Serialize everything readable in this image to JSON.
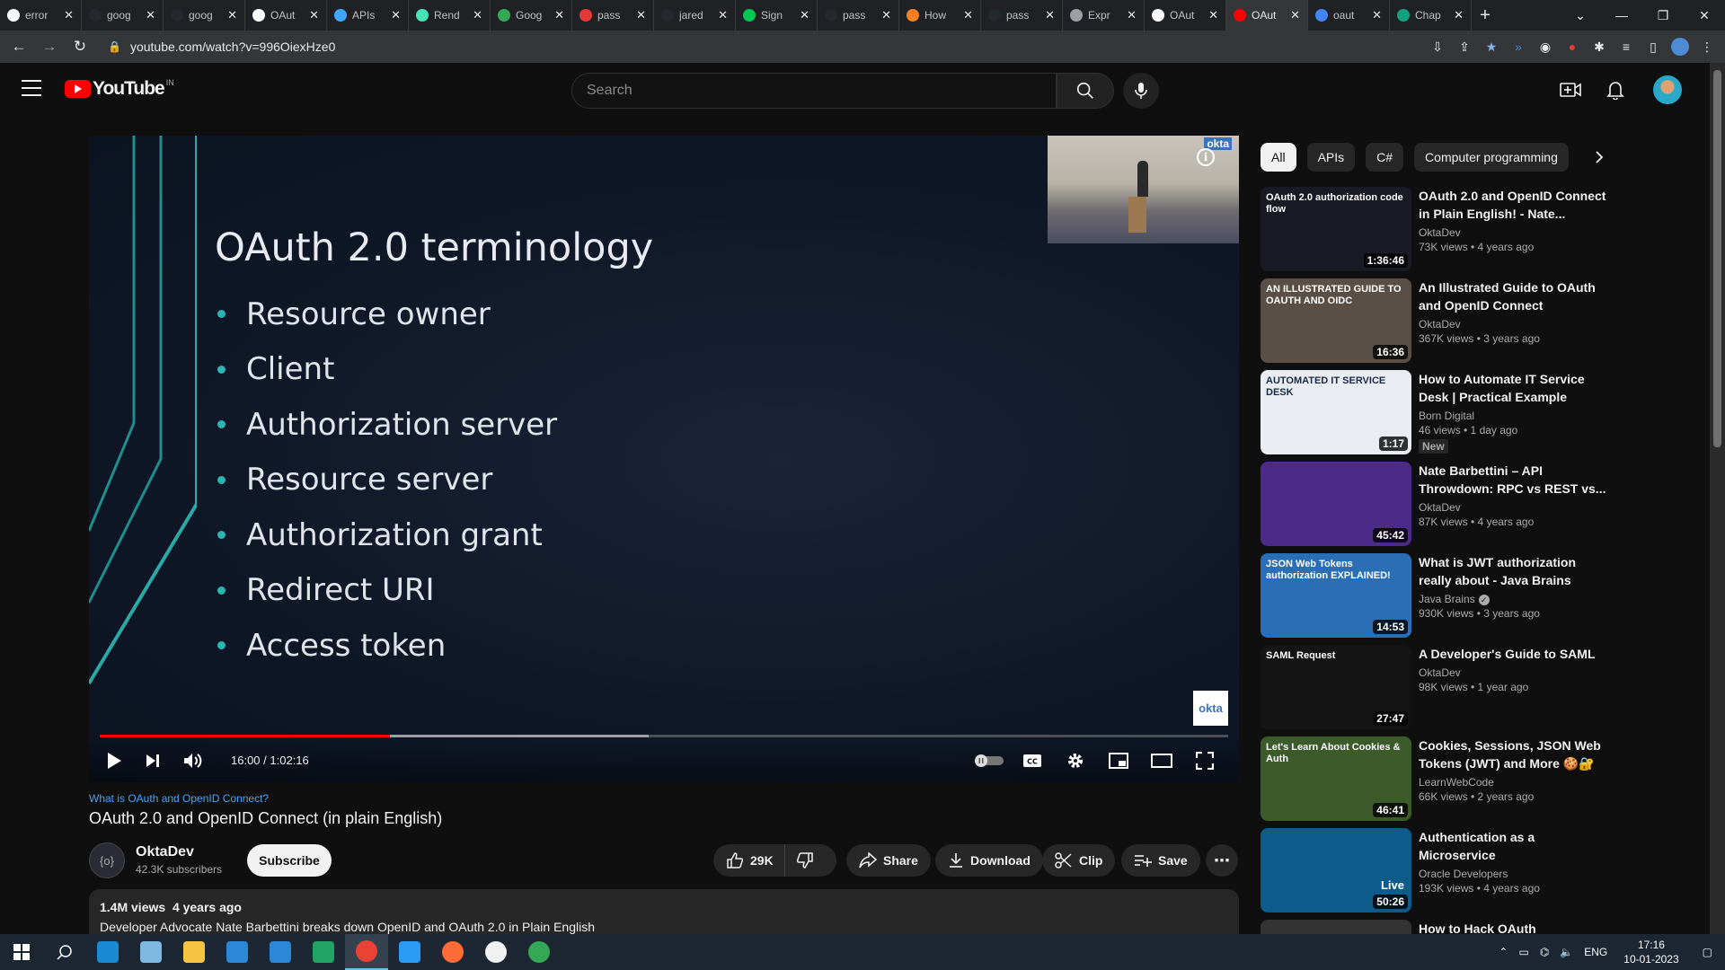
{
  "browser": {
    "tabs": [
      {
        "label": "error",
        "icon": "google-icon",
        "color": "#ffffff"
      },
      {
        "label": "goog",
        "icon": "github-icon",
        "color": "#24292f"
      },
      {
        "label": "goog",
        "icon": "github-icon",
        "color": "#24292f"
      },
      {
        "label": "OAut",
        "icon": "doc-icon",
        "color": "#ffffff"
      },
      {
        "label": "APIs",
        "icon": "api-icon",
        "color": "#3ea6ff"
      },
      {
        "label": "Rend",
        "icon": "render-icon",
        "color": "#46e3b7"
      },
      {
        "label": "Goog",
        "icon": "google-cloud-icon",
        "color": "#34a853"
      },
      {
        "label": "pass",
        "icon": "medium-icon",
        "color": "#e53935"
      },
      {
        "label": "jared",
        "icon": "github-icon",
        "color": "#24292f"
      },
      {
        "label": "Sign",
        "icon": "postman-icon",
        "color": "#00c853"
      },
      {
        "label": "pass",
        "icon": "github-icon",
        "color": "#24292f"
      },
      {
        "label": "How",
        "icon": "stack-icon",
        "color": "#f48024"
      },
      {
        "label": "pass",
        "icon": "github-icon",
        "color": "#24292f"
      },
      {
        "label": "Expr",
        "icon": "express-icon",
        "color": "#9aa0a6"
      },
      {
        "label": "OAut",
        "icon": "doc-icon",
        "color": "#ffffff"
      },
      {
        "label": "OAut",
        "icon": "youtube-icon",
        "color": "#ff0000",
        "active": true
      },
      {
        "label": "oaut",
        "icon": "docs-icon",
        "color": "#4285f4"
      },
      {
        "label": "Chap",
        "icon": "chatgpt-icon",
        "color": "#10a37f"
      }
    ],
    "url": "youtube.com/watch?v=996OiexHze0"
  },
  "youtube": {
    "logo_text": "YouTube",
    "country_code": "IN",
    "search_placeholder": "Search"
  },
  "player": {
    "slide_title": "OAuth 2.0 terminology",
    "slide_items": [
      "Resource owner",
      "Client",
      "Authorization server",
      "Resource server",
      "Authorization grant",
      "Redirect URI",
      "Access token"
    ],
    "cam_logo": "okta",
    "watermark": "okta",
    "current_time": "16:00",
    "duration": "1:02:16",
    "played_fraction": 0.2569,
    "buffered_fraction": 0.2299
  },
  "video": {
    "hashtag": "What is OAuth and OpenID Connect?",
    "title": "OAuth 2.0 and OpenID Connect (in plain English)",
    "channel": "OktaDev",
    "subscribers": "42.3K subscribers",
    "subscribe_label": "Subscribe",
    "likes": "29K",
    "share_label": "Share",
    "download_label": "Download",
    "clip_label": "Clip",
    "save_label": "Save",
    "views": "1.4M views",
    "age": "4 years ago",
    "description": "Developer Advocate Nate Barbettini breaks down OpenID and OAuth 2.0 in Plain English"
  },
  "chips": [
    "All",
    "APIs",
    "C#",
    "Computer programming"
  ],
  "recommendations": [
    {
      "title": "OAuth 2.0 and OpenID Connect in Plain English! - Nate...",
      "channel": "OktaDev",
      "stats": "73K views • 4 years ago",
      "duration": "1:36:46",
      "thumb_text": "OAuth 2.0 authorization code flow",
      "bg": "#1a1a24"
    },
    {
      "title": "An Illustrated Guide to OAuth and OpenID Connect",
      "channel": "OktaDev",
      "stats": "367K views • 3 years ago",
      "duration": "16:36",
      "thumb_text": "AN ILLUSTRATED GUIDE TO OAUTH AND OIDC",
      "bg": "#5a4f46"
    },
    {
      "title": "How to Automate IT Service Desk | Practical Example",
      "channel": "Born Digital",
      "stats": "46 views • 1 day ago",
      "duration": "1:17",
      "thumb_text": "AUTOMATED IT SERVICE DESK",
      "bg": "#e9edf2",
      "badge": "New"
    },
    {
      "title": "Nate Barbettini – API Throwdown: RPC vs REST vs...",
      "channel": "OktaDev",
      "stats": "87K views • 4 years ago",
      "duration": "45:42",
      "thumb_text": "",
      "bg": "#4b2a8a"
    },
    {
      "title": "What is JWT authorization really about - Java Brains",
      "channel": "Java Brains",
      "stats": "930K views • 3 years ago",
      "duration": "14:53",
      "thumb_text": "JSON Web Tokens authorization EXPLAINED!",
      "bg": "#2a6fb5",
      "verified": true
    },
    {
      "title": "A Developer's Guide to SAML",
      "channel": "OktaDev",
      "stats": "98K views • 1 year ago",
      "duration": "27:47",
      "thumb_text": "SAML Request",
      "bg": "#141414"
    },
    {
      "title": "Cookies, Sessions, JSON Web Tokens (JWT) and More 🍪🔐",
      "channel": "LearnWebCode",
      "stats": "66K views • 2 years ago",
      "duration": "46:41",
      "thumb_text": "Let's Learn About Cookies & Auth",
      "bg": "#3d5a2a"
    },
    {
      "title": "Authentication as a Microservice",
      "channel": "Oracle Developers",
      "stats": "193K views • 4 years ago",
      "duration": "50:26",
      "thumb_text": "",
      "bg": "#0d5b8a",
      "live_label": "Live"
    },
    {
      "title": "How to Hack OAuth",
      "channel": "",
      "stats": "",
      "duration": "",
      "thumb_text": "",
      "bg": "#333333"
    }
  ],
  "taskbar": {
    "apps": [
      {
        "name": "edge-icon",
        "color": "#1a8ad4"
      },
      {
        "name": "notepad-icon",
        "color": "#7fb8e0"
      },
      {
        "name": "file-explorer-icon",
        "color": "#f5c542"
      },
      {
        "name": "store-icon",
        "color": "#2b88d8"
      },
      {
        "name": "mail-icon",
        "color": "#2b88d8"
      },
      {
        "name": "sheets-icon",
        "color": "#21a366"
      },
      {
        "name": "chrome-icon",
        "color": "#ea4335",
        "active": true
      },
      {
        "name": "vscode-icon",
        "color": "#2b9af3"
      },
      {
        "name": "postman-icon",
        "color": "#ff6c37"
      },
      {
        "name": "mongodb-compass-icon",
        "color": "#f2f2f2"
      },
      {
        "name": "chrome-alt-icon",
        "color": "#34a853"
      }
    ],
    "lang": "ENG",
    "time": "17:16",
    "date": "10-01-2023"
  }
}
